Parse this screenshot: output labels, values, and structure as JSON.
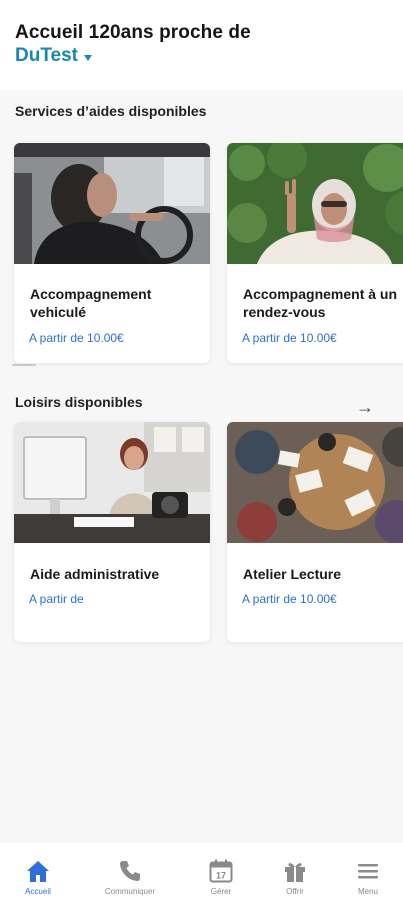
{
  "header": {
    "title": "Accueil 120ans proche de",
    "user_name": "DuTest"
  },
  "services": {
    "section_title": "Services d’aides disponibles",
    "cards": [
      {
        "title": "Accompagnement vehiculé",
        "price": "A partir de 10.00€"
      },
      {
        "title": "Accompagnement à un rendez-vous",
        "price": "A partir de 10.00€"
      }
    ]
  },
  "loisirs": {
    "section_title": "Loisirs disponibles",
    "arrow": "→",
    "cards": [
      {
        "title": "Aide administrative",
        "price": "A partir de"
      },
      {
        "title": "Atelier Lecture",
        "price": "A partir de 10.00€"
      }
    ]
  },
  "nav": {
    "items": [
      {
        "label": "Accueil",
        "icon": "home-icon",
        "active": true
      },
      {
        "label": "Communiquer",
        "icon": "phone-icon",
        "active": false
      },
      {
        "label": "Gérer",
        "icon": "calendar-icon",
        "active": false
      },
      {
        "label": "Offrir",
        "icon": "gift-icon",
        "active": false
      },
      {
        "label": "Menu",
        "icon": "menu-icon",
        "active": false
      }
    ],
    "calendar_day": "17"
  },
  "colors": {
    "accent": "#1a86b4",
    "price": "#2d6fd6",
    "active_nav": "#2d6fd6",
    "inactive_nav": "#8a8a8a"
  }
}
